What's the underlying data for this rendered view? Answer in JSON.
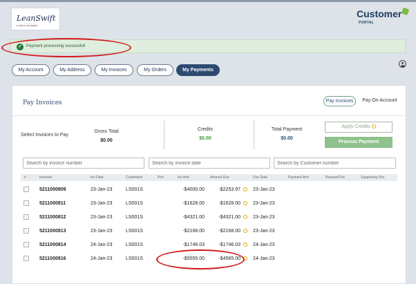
{
  "logo": {
    "name": "LeanSwift",
    "tagline": "a wipro company"
  },
  "brand": {
    "name": "Customer",
    "sub": "PORTAL"
  },
  "alert": {
    "message": "Payment processing successful!"
  },
  "nav": {
    "tabs": [
      {
        "label": "My Account"
      },
      {
        "label": "My Address"
      },
      {
        "label": "My Invoices"
      },
      {
        "label": "My Orders"
      },
      {
        "label": "My Payments"
      }
    ]
  },
  "panel": {
    "title": "Pay Invoices",
    "tabs": [
      {
        "label": "Pay Invoices"
      },
      {
        "label": "Pay On Account"
      }
    ]
  },
  "summary": {
    "select_label": "Select Invoices to Pay",
    "gross_label": "Gross Total",
    "gross_value": "$0.00",
    "credits_label": "Credits",
    "credits_value": "$0.00",
    "total_label": "Total Payment",
    "total_value": "$0.00",
    "apply_credits": "Apply Credits",
    "process_payment": "Process Payment"
  },
  "search": {
    "invoice_number": "Search by invoice number",
    "invoice_date": "Search by invoice date",
    "customer_number": "Search by Customer number"
  },
  "table": {
    "headers": [
      "#",
      "Invoice#",
      "Inv Date",
      "Customer#",
      "Po#",
      "Inv Amt",
      "Amount Due",
      "Due Date",
      "Payment Amt",
      "Reason/Cmt",
      "Supporting Doc"
    ],
    "rows": [
      {
        "invoice": "5211000809",
        "inv_date": "23-Jan-23",
        "customer": "LS001S",
        "po": "",
        "inv_amt": "-$4000.00",
        "amount_due": "-$2253.97",
        "due_date": "23-Jan-23"
      },
      {
        "invoice": "5211000811",
        "inv_date": "23-Jan-23",
        "customer": "LS001S",
        "po": "",
        "inv_amt": "-$1628.00",
        "amount_due": "-$1628.00",
        "due_date": "23-Jan-23"
      },
      {
        "invoice": "5211000812",
        "inv_date": "23-Jan-23",
        "customer": "LS001S",
        "po": "",
        "inv_amt": "-$4321.00",
        "amount_due": "-$4321.00",
        "due_date": "23-Jan-23"
      },
      {
        "invoice": "5211000813",
        "inv_date": "23-Jan-23",
        "customer": "LS001S",
        "po": "",
        "inv_amt": "-$2168.00",
        "amount_due": "-$2168.00",
        "due_date": "23-Jan-23"
      },
      {
        "invoice": "5211000814",
        "inv_date": "24-Jan-23",
        "customer": "LS001S",
        "po": "",
        "inv_amt": "-$1746.03",
        "amount_due": "-$1746.03",
        "due_date": "24-Jan-23"
      },
      {
        "invoice": "5211000816",
        "inv_date": "24-Jan-23",
        "customer": "LS001S",
        "po": "",
        "inv_amt": "-$5555.00",
        "amount_due": "-$4565.00",
        "due_date": "24-Jan-23"
      }
    ]
  },
  "icons": {
    "alert": "check-circle-icon",
    "amount_due": "coin-icon",
    "user": "user-circle-icon"
  },
  "colors": {
    "primary": "#2c4970",
    "success": "#1f7a34",
    "accent": "#8ec18c",
    "annotation": "#d11a1a"
  }
}
